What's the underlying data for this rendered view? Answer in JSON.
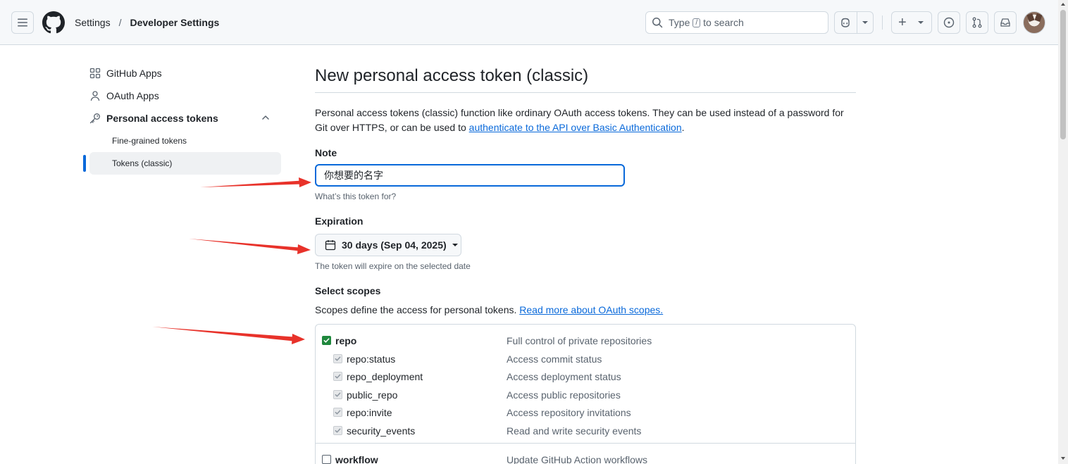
{
  "header": {
    "breadcrumb": [
      "Settings",
      "Developer Settings"
    ],
    "breadcrumb_separator": "/",
    "search": {
      "prefix": "Type",
      "key": "/",
      "suffix": "to search"
    },
    "create_label": "+"
  },
  "sidebar": {
    "items": [
      {
        "label": "GitHub Apps",
        "icon": "apps-icon"
      },
      {
        "label": "OAuth Apps",
        "icon": "person-icon"
      },
      {
        "label": "Personal access tokens",
        "icon": "key-icon",
        "expanded": true
      }
    ],
    "subitems": [
      {
        "label": "Fine-grained tokens",
        "active": false
      },
      {
        "label": "Tokens (classic)",
        "active": true
      }
    ],
    "accent": "#0969da"
  },
  "main": {
    "title": "New personal access token (classic)",
    "intro_text": "Personal access tokens (classic) function like ordinary OAuth access tokens. They can be used instead of a password for Git over HTTPS, or can be used to ",
    "intro_link": "authenticate to the API over Basic Authentication",
    "intro_end": ".",
    "note": {
      "label": "Note",
      "value": "你想要的名字",
      "hint": "What’s this token for?"
    },
    "expiration": {
      "label": "Expiration",
      "selected": "30 days (Sep 04, 2025)",
      "hint": "The token will expire on the selected date"
    },
    "scopes": {
      "label": "Select scopes",
      "desc": "Scopes define the access for personal tokens. ",
      "desc_link": "Read more about OAuth scopes.",
      "rows": [
        {
          "name": "repo",
          "desc": "Full control of private repositories",
          "state": "checked",
          "level": 0
        },
        {
          "name": "repo:status",
          "desc": "Access commit status",
          "state": "disabled-checked",
          "level": 1
        },
        {
          "name": "repo_deployment",
          "desc": "Access deployment status",
          "state": "disabled-checked",
          "level": 1
        },
        {
          "name": "public_repo",
          "desc": "Access public repositories",
          "state": "disabled-checked",
          "level": 1
        },
        {
          "name": "repo:invite",
          "desc": "Access repository invitations",
          "state": "disabled-checked",
          "level": 1
        },
        {
          "name": "security_events",
          "desc": "Read and write security events",
          "state": "disabled-checked",
          "level": 1
        },
        {
          "name": "workflow",
          "desc": "Update GitHub Action workflows",
          "state": "unchecked",
          "level": 0
        }
      ]
    }
  },
  "colors": {
    "checkbox_checked": "#1f883d",
    "link": "#0969da",
    "annotation_arrow": "#e8322a"
  }
}
